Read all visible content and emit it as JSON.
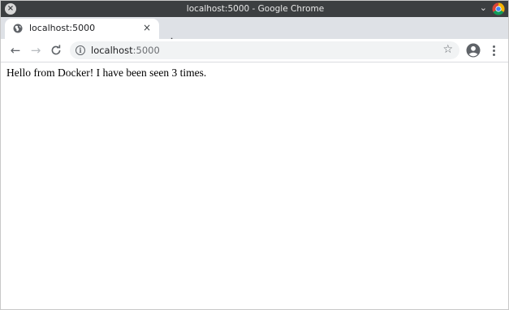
{
  "window": {
    "title": "localhost:5000 - Google Chrome",
    "close_symbol": "×",
    "chevron_symbol": "⌄"
  },
  "tabs": [
    {
      "title": "localhost:5000",
      "close_symbol": "×",
      "favicon": "globe-icon"
    }
  ],
  "new_tab_symbol": "+",
  "toolbar": {
    "back_symbol": "←",
    "forward_symbol": "→",
    "reload_symbol": "C",
    "forward_enabled": false
  },
  "omnibox": {
    "info_symbol": "i",
    "url_host": "localhost",
    "url_port": ":5000",
    "star_symbol": "☆"
  },
  "page": {
    "message": "Hello from Docker! I have been seen 3 times."
  },
  "colors": {
    "titlebar": "#3c3f41",
    "tabstrip": "#dee1e6",
    "omnibox": "#f1f3f4",
    "icon": "#5f6368"
  }
}
